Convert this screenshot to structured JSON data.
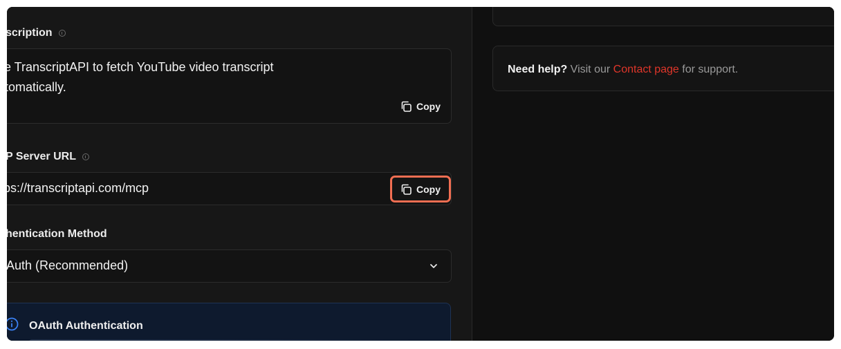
{
  "description": {
    "label": "scription",
    "line1": "se TranscriptAPI to fetch YouTube video transcript",
    "line2": "utomatically.",
    "copy_label": "Copy"
  },
  "mcp_server_url": {
    "label": "P Server URL",
    "value": "ttps://transcriptapi.com/mcp",
    "copy_label": "Copy"
  },
  "auth_method": {
    "label": "hentication Method",
    "selected": "OAuth (Recommended)"
  },
  "oauth_card": {
    "title": "OAuth Authentication"
  },
  "help": {
    "strong": "Need help?",
    "pre": " Visit our ",
    "link": "Contact page",
    "post": " for support."
  },
  "colors": {
    "highlight": "#f26e52",
    "link": "#e0362a",
    "info_blue": "#3b82f6"
  }
}
